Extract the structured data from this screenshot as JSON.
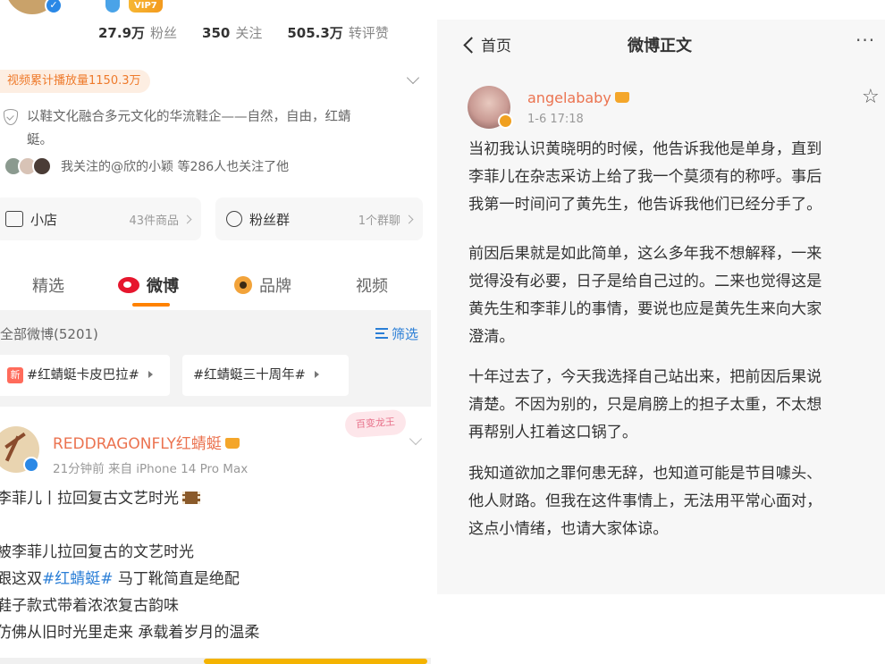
{
  "left_panel": {
    "badges": {
      "vip": "VIP7"
    },
    "stats": [
      {
        "num": "27.9万",
        "label": "粉丝"
      },
      {
        "num": "350",
        "label": "关注"
      },
      {
        "num": "505.3万",
        "label": "转评赞"
      }
    ],
    "views_badge": "视频累计播放量1150.3万",
    "bio_line1": "以鞋文化融合多元文化的华流鞋企——自然，自由，红蜻",
    "bio_line2": "蜓。",
    "followers_note": "我关注的@欣的小颖 等286人也关注了他",
    "shop": {
      "label": "小店",
      "meta": "43件商品"
    },
    "fan_group": {
      "label": "粉丝群",
      "meta": "1个群聊"
    },
    "tabs": [
      "精选",
      "微博",
      "品牌",
      "视频"
    ],
    "all_weibo": "全部微博(5201)",
    "filter": "筛选",
    "tags": [
      {
        "badge": "新",
        "text": "#红蜻蜓卡皮巴拉#"
      },
      {
        "text": "#红蜻蜓三十周年#"
      }
    ],
    "post": {
      "author": "REDDRAGONFLY红蜻蜓",
      "meta": "21分钟前  来自 iPhone 14 Pro Max",
      "sticker": "百变龙王",
      "line1": "李菲儿丨拉回复古文艺时光",
      "line2": "被李菲儿拉回复古的文艺时光",
      "line3_pre": "跟这双",
      "line3_topic": "#红蜻蜓#",
      "line3_post": " 马丁靴简直是绝配",
      "line4": "鞋子款式带着浓浓复古韵味",
      "line5": "仿佛从旧时光里走来 承载着岁月的温柔"
    }
  },
  "right_panel": {
    "back_label": "首页",
    "title": "微博正文",
    "more": "···",
    "author": "angelababy",
    "date": "1-6 17:18",
    "paragraphs": {
      "p1": [
        "当初我认识黄晓明的时候，他告诉我他是单身，直到",
        "李菲儿在杂志采访上给了我一个莫须有的称呼。事后",
        "我第一时间问了黄先生，他告诉我他们已经分手了。"
      ],
      "p2": [
        "前因后果就是如此简单，这么多年我不想解释，一来",
        "觉得没有必要，日子是给自己过的。二来也觉得这是",
        "黄先生和李菲儿的事情，要说也应是黄先生来向大家",
        "澄清。"
      ],
      "p3": [
        "十年过去了，今天我选择自己站出来，把前因后果说",
        "清楚。不因为别的，只是肩膀上的担子太重，不太想",
        "再帮别人扛着这口锅了。"
      ],
      "p4": [
        "我知道欲加之罪何患无辞，也知道可能是节目噱头、",
        "他人财路。但我在这件事情上，无法用平常心面对，",
        "这点小情绪，也请大家体谅。"
      ]
    }
  },
  "colors": {
    "accent_orange": "#ff8200",
    "name_orange": "#eb7350",
    "link_blue": "#2a7ed6",
    "weibo_red": "#e6162d"
  }
}
